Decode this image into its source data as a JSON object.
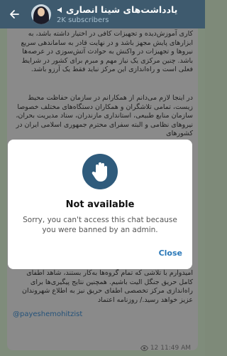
{
  "header": {
    "title": "یادداشت‌های شینا انصاری",
    "subtitle": "2K subscribers"
  },
  "post": {
    "p1": "کاری آموزش‌دیده و تجهیزات کافی در اختیار داشته باشد، به ابزارهای پایش مجهز باشد و در نهایت قادر به ساماندهی سریع نیروها و تجهیزات در واکنش به حوادث آتش‌سوزی در عرصه‌ها باشد. چنین مرکزی یک نیاز مهم و مبرم برای کشور در شرایط فعلی است و راه‌اندازی این مرکز نباید فقط یک آرزو باشد.",
    "p2": "در اینجا لازم می‌دانم از همکارانم در سازمان حفاظت محیط زیست، تمامی تلاشگران و همکاران دستگاه‌های مختلف خصوصا سازمان منابع طبیعی، استانداری مازندران، ستاد مدیریت بحران، نیروهای نظامی و البته سفرای محترم جمهوری اسلامی ایران در کشورهای",
    "p3": "امیدوارم با تلاشی که تمام گروه‌ها به‌کار بستند، شاهد اطفای کامل حریق جنگل الیت باشیم. همچنین نتایج پیگیری‌ها برای راه‌اندازی مرکز تخصصی اطفای حریق نیز به اطلاع شهروندان عزیز خواهد رسید./ روزنامه اعتماد",
    "handle": "@payeshemohitzist",
    "views": "12",
    "time": "11:49 AM"
  },
  "dialog": {
    "title": "Not available",
    "message": "Sorry, you can't access this chat because you were banned by an admin.",
    "close_label": "Close"
  },
  "colors": {
    "header_bg": "#3e5a6e",
    "accent": "#2a78b8",
    "icon_circle": "#2f5b7c"
  }
}
